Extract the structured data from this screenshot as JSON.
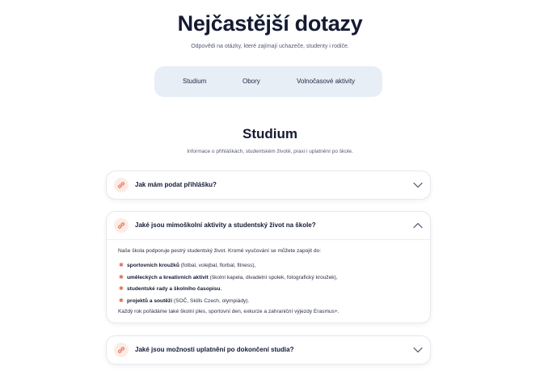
{
  "hero": {
    "title": "Nejčastější dotazy",
    "subtitle": "Odpovědi na otázky, které zajímají uchazeče, studenty i rodiče."
  },
  "tabs": [
    {
      "label": "Studium"
    },
    {
      "label": "Obory"
    },
    {
      "label": "Volnočasové aktivity"
    }
  ],
  "section": {
    "title": "Studium",
    "subtitle": "Informace o přihláškách, studentském životě, praxi i uplatnění po škole."
  },
  "faq": [
    {
      "question": "Jak mám podat přihlášku?",
      "expanded": false,
      "icon": "chevron-down-icon"
    },
    {
      "question": "Jaké jsou mimoškolní aktivity a studentský život na škole?",
      "expanded": true,
      "icon": "chevron-up-icon",
      "answer": {
        "intro": "Naše škola podporuje pestrý studentský život. Kromě vyučování se můžete zapojit do:",
        "items": [
          {
            "bold": "sportovních kroužků",
            "rest": " (fotbal, volejbal, florbal, fitness),"
          },
          {
            "bold": "uměleckých a kreativních aktivit",
            "rest": " (školní kapela, divadelní spolek, fotografický kroužek),"
          },
          {
            "bold": "studentské rady a školního časopisu",
            "rest": ","
          },
          {
            "bold": "projektů a soutěží",
            "rest": " (SOČ, Skills Czech, olympiády)."
          }
        ],
        "outro": "Každý rok pořádáme také školní ples, sportovní den, exkurze a zahraniční výjezdy Erasmus+."
      }
    },
    {
      "question": "Jaké jsou možnosti uplatnění po dokončení studia?",
      "expanded": false,
      "icon": "chevron-down-icon"
    }
  ],
  "colors": {
    "accent": "#e8623d",
    "accent_bg": "#fdece6",
    "tabs_bg": "#e8eef6",
    "heading": "#141a33"
  },
  "icons": {
    "question": "link-icon",
    "bullet": "star-icon"
  }
}
